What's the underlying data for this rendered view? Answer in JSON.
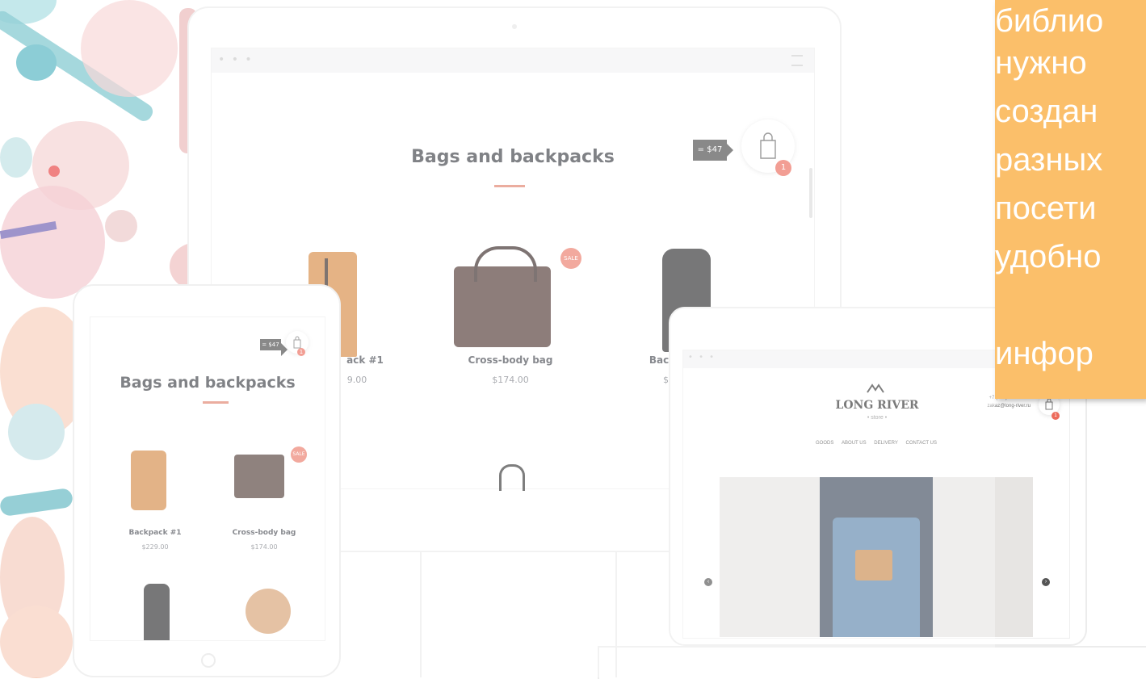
{
  "desktop": {
    "dots": "• • •",
    "heading": "Bags and backpacks",
    "cart_total": "= $47",
    "cart_count": "1",
    "sale_badge": "SALE",
    "products": [
      {
        "name": "ack #1",
        "price": "9.00"
      },
      {
        "name": "Cross-body bag",
        "price": "$174.00"
      },
      {
        "name": "Back",
        "price": "$2"
      }
    ]
  },
  "tablet": {
    "heading": "Bags and backpacks",
    "cart_total": "= $47",
    "cart_count": "1",
    "sale_badge": "SALE",
    "products": [
      {
        "name": "Backpack #1",
        "price": "$229.00"
      },
      {
        "name": "Cross-body bag",
        "price": "$174.00"
      }
    ]
  },
  "laptop": {
    "dots": "• • •",
    "logo_name": "LONG RIVER",
    "logo_sub": "• store •",
    "phone": "+7 (495) 104-36-89",
    "email": "zakaz@long-river.ru",
    "cart_count": "1",
    "nav": [
      "GOODS",
      "ABOUT US",
      "DELIVERY",
      "CONTACT US"
    ]
  },
  "note": {
    "lines": [
      "библио",
      "нужно",
      "создан",
      "разных",
      "посети",
      "удобно",
      "инфор"
    ]
  },
  "colors": {
    "accent": "#ec6b5b",
    "note_bg": "#fbbf6a"
  }
}
